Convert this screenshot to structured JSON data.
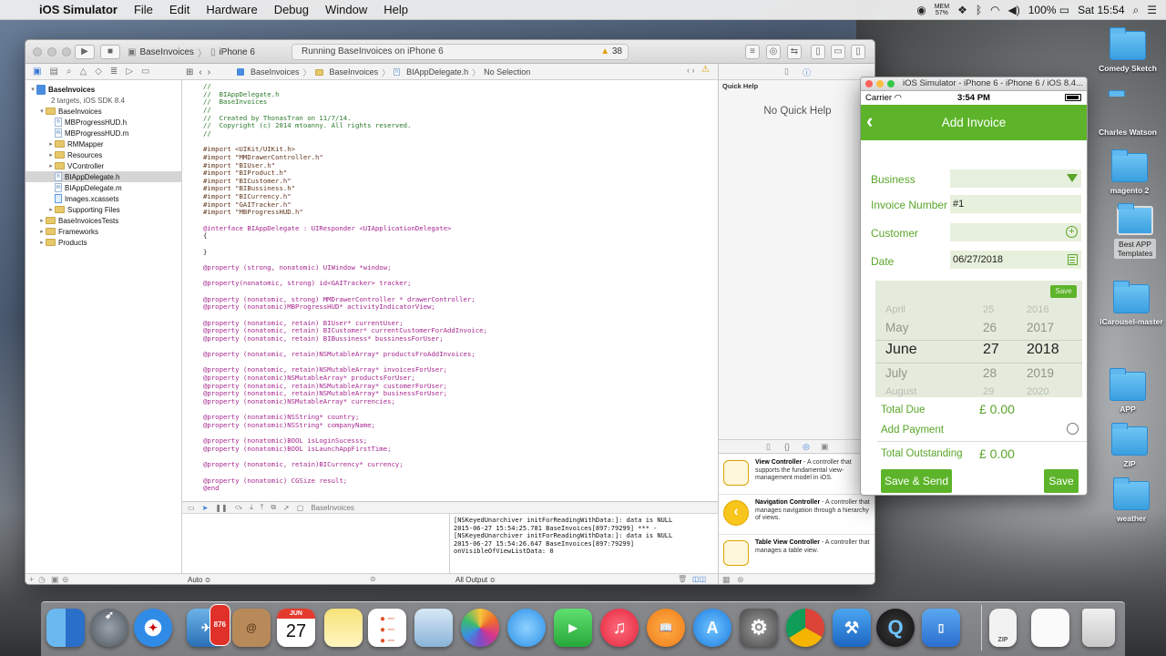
{
  "menubar": {
    "app_name": "iOS Simulator",
    "items": [
      "File",
      "Edit",
      "Hardware",
      "Debug",
      "Window",
      "Help"
    ],
    "status": {
      "mem_label": "MEM",
      "mem_value": "57%",
      "battery": "100%",
      "clock": "Sat 15:54"
    }
  },
  "xcode": {
    "scheme": "BaseInvoices",
    "device": "iPhone 6",
    "activity": "Running BaseInvoices on iPhone 6",
    "warnings": "38",
    "jumpbar": [
      "BaseInvoices",
      "BaseInvoices",
      "BIAppDelegate.h",
      "No Selection"
    ],
    "navigator": [
      {
        "label": "BaseInvoices",
        "indent": 0,
        "icon": "project",
        "bold": true,
        "disc": "▾"
      },
      {
        "label": "2 targets, iOS SDK 8.4",
        "indent": 0,
        "icon": "none",
        "disc": ""
      },
      {
        "label": "BaseInvoices",
        "indent": 1,
        "icon": "folder",
        "disc": "▾"
      },
      {
        "label": "MBProgressHUD.h",
        "indent": 2,
        "icon": "h",
        "disc": ""
      },
      {
        "label": "MBProgressHUD.m",
        "indent": 2,
        "icon": "m",
        "disc": ""
      },
      {
        "label": "RMMapper",
        "indent": 2,
        "icon": "folder",
        "disc": "▸"
      },
      {
        "label": "Resources",
        "indent": 2,
        "icon": "folder",
        "disc": "▸"
      },
      {
        "label": "VController",
        "indent": 2,
        "icon": "folder",
        "disc": "▸"
      },
      {
        "label": "BIAppDelegate.h",
        "indent": 2,
        "icon": "h",
        "disc": "",
        "selected": true
      },
      {
        "label": "BIAppDelegate.m",
        "indent": 2,
        "icon": "m",
        "disc": ""
      },
      {
        "label": "Images.xcassets",
        "indent": 2,
        "icon": "assets",
        "disc": ""
      },
      {
        "label": "Supporting Files",
        "indent": 2,
        "icon": "folder",
        "disc": "▸"
      },
      {
        "label": "BaseInvoicesTests",
        "indent": 1,
        "icon": "folder",
        "disc": "▸"
      },
      {
        "label": "Frameworks",
        "indent": 1,
        "icon": "folder",
        "disc": "▸"
      },
      {
        "label": "Products",
        "indent": 1,
        "icon": "folder",
        "disc": "▸"
      }
    ],
    "code": [
      {
        "t": "//",
        "c": "cm"
      },
      {
        "t": "//  BIAppDelegate.h",
        "c": "cm"
      },
      {
        "t": "//  BaseInvoices",
        "c": "cm"
      },
      {
        "t": "//",
        "c": "cm"
      },
      {
        "t": "//  Created by ThonasTran on 11/7/14.",
        "c": "cm"
      },
      {
        "t": "//  Copyright (c) 2014 mtoanny. All rights reserved.",
        "c": "cm"
      },
      {
        "t": "//",
        "c": "cm"
      },
      {
        "t": "",
        "c": ""
      },
      {
        "t": "#import <UIKit/UIKit.h>",
        "c": "pp"
      },
      {
        "t": "#import \"MMDrawerController.h\"",
        "c": "pp"
      },
      {
        "t": "#import \"BIUser.h\"",
        "c": "pp"
      },
      {
        "t": "#import \"BIProduct.h\"",
        "c": "pp"
      },
      {
        "t": "#import \"BICustomer.h\"",
        "c": "pp"
      },
      {
        "t": "#import \"BIBussiness.h\"",
        "c": "pp"
      },
      {
        "t": "#import \"BICurrency.h\"",
        "c": "pp"
      },
      {
        "t": "#import \"GAITracker.h\"",
        "c": "pp"
      },
      {
        "t": "#import \"MBProgressHUD.h\"",
        "c": "pp"
      },
      {
        "t": "",
        "c": ""
      },
      {
        "t": "@interface BIAppDelegate : UIResponder <UIApplicationDelegate>",
        "c": "kw"
      },
      {
        "t": "{",
        "c": ""
      },
      {
        "t": "",
        "c": ""
      },
      {
        "t": "}",
        "c": ""
      },
      {
        "t": "",
        "c": ""
      },
      {
        "t": "@property (strong, nonatomic) UIWindow *window;",
        "c": "kw"
      },
      {
        "t": "",
        "c": ""
      },
      {
        "t": "@property(nonatomic, strong) id<GAITracker> tracker;",
        "c": "kw"
      },
      {
        "t": "",
        "c": ""
      },
      {
        "t": "@property (nonatomic, strong) MMDrawerController * drawerController;",
        "c": "kw"
      },
      {
        "t": "@property (nonatomic)MBProgressHUD* activityIndicatorView;",
        "c": "kw"
      },
      {
        "t": "",
        "c": ""
      },
      {
        "t": "@property (nonatomic, retain) BIUser* currentUser;",
        "c": "kw"
      },
      {
        "t": "@property (nonatomic, retain) BICustomer* currentCustomerForAddInvoice;",
        "c": "kw"
      },
      {
        "t": "@property (nonatomic, retain) BIBussiness* bussinessForUser;",
        "c": "kw"
      },
      {
        "t": "",
        "c": ""
      },
      {
        "t": "@property (nonatomic, retain)NSMutableArray* productsFroAddInvoices;",
        "c": "kw"
      },
      {
        "t": "",
        "c": ""
      },
      {
        "t": "@property (nonatomic, retain)NSMutableArray* invoicesForUser;",
        "c": "kw"
      },
      {
        "t": "@property (nonatomic)NSMutableArray* productsForUser;",
        "c": "kw"
      },
      {
        "t": "@property (nonatomic, retain)NSMutableArray* customerForUser;",
        "c": "kw"
      },
      {
        "t": "@property (nonatomic, retain)NSMutableArray* businessForUser;",
        "c": "kw"
      },
      {
        "t": "@property (nonatomic)NSMutableArray* currencies;",
        "c": "kw"
      },
      {
        "t": "",
        "c": ""
      },
      {
        "t": "@property (nonatomic)NSString* country;",
        "c": "kw"
      },
      {
        "t": "@property (nonatomic)NSString* companyName;",
        "c": "kw"
      },
      {
        "t": "",
        "c": ""
      },
      {
        "t": "@property (nonatomic)BOOL isLoginSucesss;",
        "c": "kw"
      },
      {
        "t": "@property (nonatomic)BOOL isLaunchAppFirstTime;",
        "c": "kw"
      },
      {
        "t": "",
        "c": ""
      },
      {
        "t": "@property (nonatomic, retain)BICurrency* currency;",
        "c": "kw"
      },
      {
        "t": "",
        "c": ""
      },
      {
        "t": "@property (nonatomic) CGSize result;",
        "c": "kw"
      },
      {
        "t": "@end",
        "c": "kw"
      }
    ],
    "debug_target": "BaseInvoices",
    "console_text": "[NSKeyedUnarchiver initForReadingWithData:]: data is NULL\n2015-06-27 15:54:25.781 BaseInvoices[897:79299] *** -\n[NSKeyedUnarchiver initForReadingWithData:]: data is NULL\n2015-06-27 15:54:26.647 BaseInvoices[897:79299]\nonVisibleOfViewListData: 0",
    "auto_label": "Auto ≎",
    "all_output_label": "All Output ≎",
    "quick_help_title": "Quick Help",
    "no_quick_help": "No Quick Help",
    "library": [
      {
        "name": "View Controller",
        "desc": " - A controller that supports the fundamental view-management model in iOS.",
        "icon": "square"
      },
      {
        "name": "Navigation Controller",
        "desc": " - A controller that manages navigation through a hierarchy of views.",
        "icon": "back"
      },
      {
        "name": "Table View Controller",
        "desc": " - A controller that manages a table view.",
        "icon": "list"
      }
    ]
  },
  "simulator": {
    "window_title": "iOS Simulator - iPhone 6 - iPhone 6 / iOS 8.4...",
    "carrier": "Carrier",
    "time": "3:54 PM",
    "nav_title": "Add Invoice",
    "business_label": "Business",
    "business_value": "",
    "invoice_number_label": "Invoice Number",
    "invoice_number_value": "#1",
    "customer_label": "Customer",
    "customer_value": "",
    "date_label": "Date",
    "date_value": "06/27/2018",
    "picker_save": "Save",
    "picker": {
      "months": [
        "April",
        "May",
        "June",
        "July",
        "August"
      ],
      "days": [
        "25",
        "26",
        "27",
        "28",
        "29"
      ],
      "years": [
        "2016",
        "2017",
        "2018",
        "2019",
        "2020"
      ],
      "selected_index": 2
    },
    "total_due_label": "Total Due",
    "total_due_value": "£ 0.00",
    "add_payment_label": "Add Payment",
    "total_outstanding_label": "Total Outstanding",
    "total_outstanding_value": "£ 0.00",
    "save_send_label": "Save & Send",
    "save_label": "Save",
    "accent_color": "#5db42a"
  },
  "desktop": {
    "items": [
      "Comedy Sketch",
      "Charles Watson",
      "magento 2",
      "Best APP Templates",
      "iCarousel-master",
      "APP",
      "ZIP",
      "weather"
    ]
  },
  "dock": {
    "calendar_month": "JUN",
    "calendar_day": "27",
    "mail_badge": "876",
    "apps": [
      "finder",
      "launchpad",
      "safari",
      "mail",
      "contacts",
      "calendar",
      "notes",
      "reminders",
      "preview",
      "photos",
      "messages",
      "facetime",
      "itunes",
      "ibooks",
      "app-store",
      "system-preferences",
      "chrome",
      "xcode",
      "quicktime",
      "simulator",
      "zip-archive",
      "chrome-document",
      "trash"
    ]
  }
}
